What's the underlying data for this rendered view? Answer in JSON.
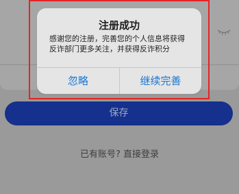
{
  "dialog": {
    "title": "注册成功",
    "message": "感谢您的注册，完善您的个人信息将获得反诈部门更多关注，并获得反诈积分",
    "buttons": {
      "ignore": "忽略",
      "continue": "继续完善"
    }
  },
  "form": {
    "save_label": "保存"
  },
  "footer": {
    "login_prefix": "已有账号?",
    "login_action": "直接登录"
  },
  "icons": {
    "password_visibility": "eye-closed-icon"
  },
  "colors": {
    "accent": "#1976d2",
    "primary_button": "#15308d",
    "highlight": "#e52323"
  }
}
